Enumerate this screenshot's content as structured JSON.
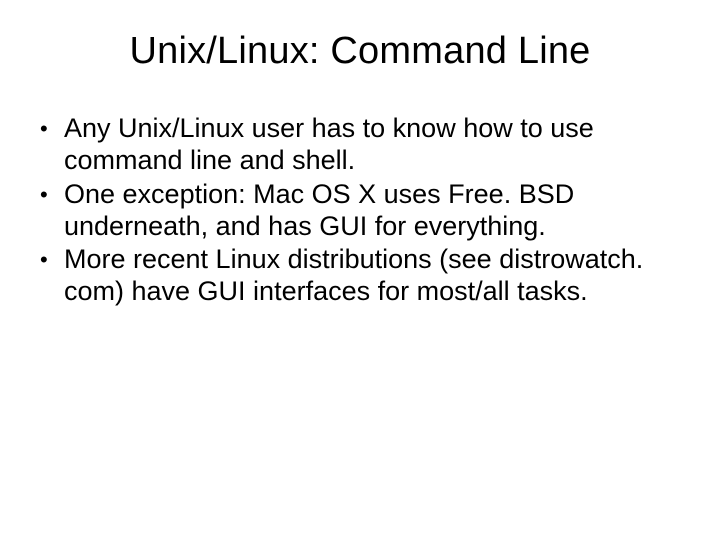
{
  "slide": {
    "title": "Unix/Linux: Command Line",
    "bullets": [
      "Any Unix/Linux user has to know how to use command line and shell.",
      "One exception: Mac OS X uses Free. BSD underneath, and has GUI for everything.",
      "More recent Linux distributions (see distrowatch. com) have GUI interfaces for most/all tasks."
    ]
  }
}
